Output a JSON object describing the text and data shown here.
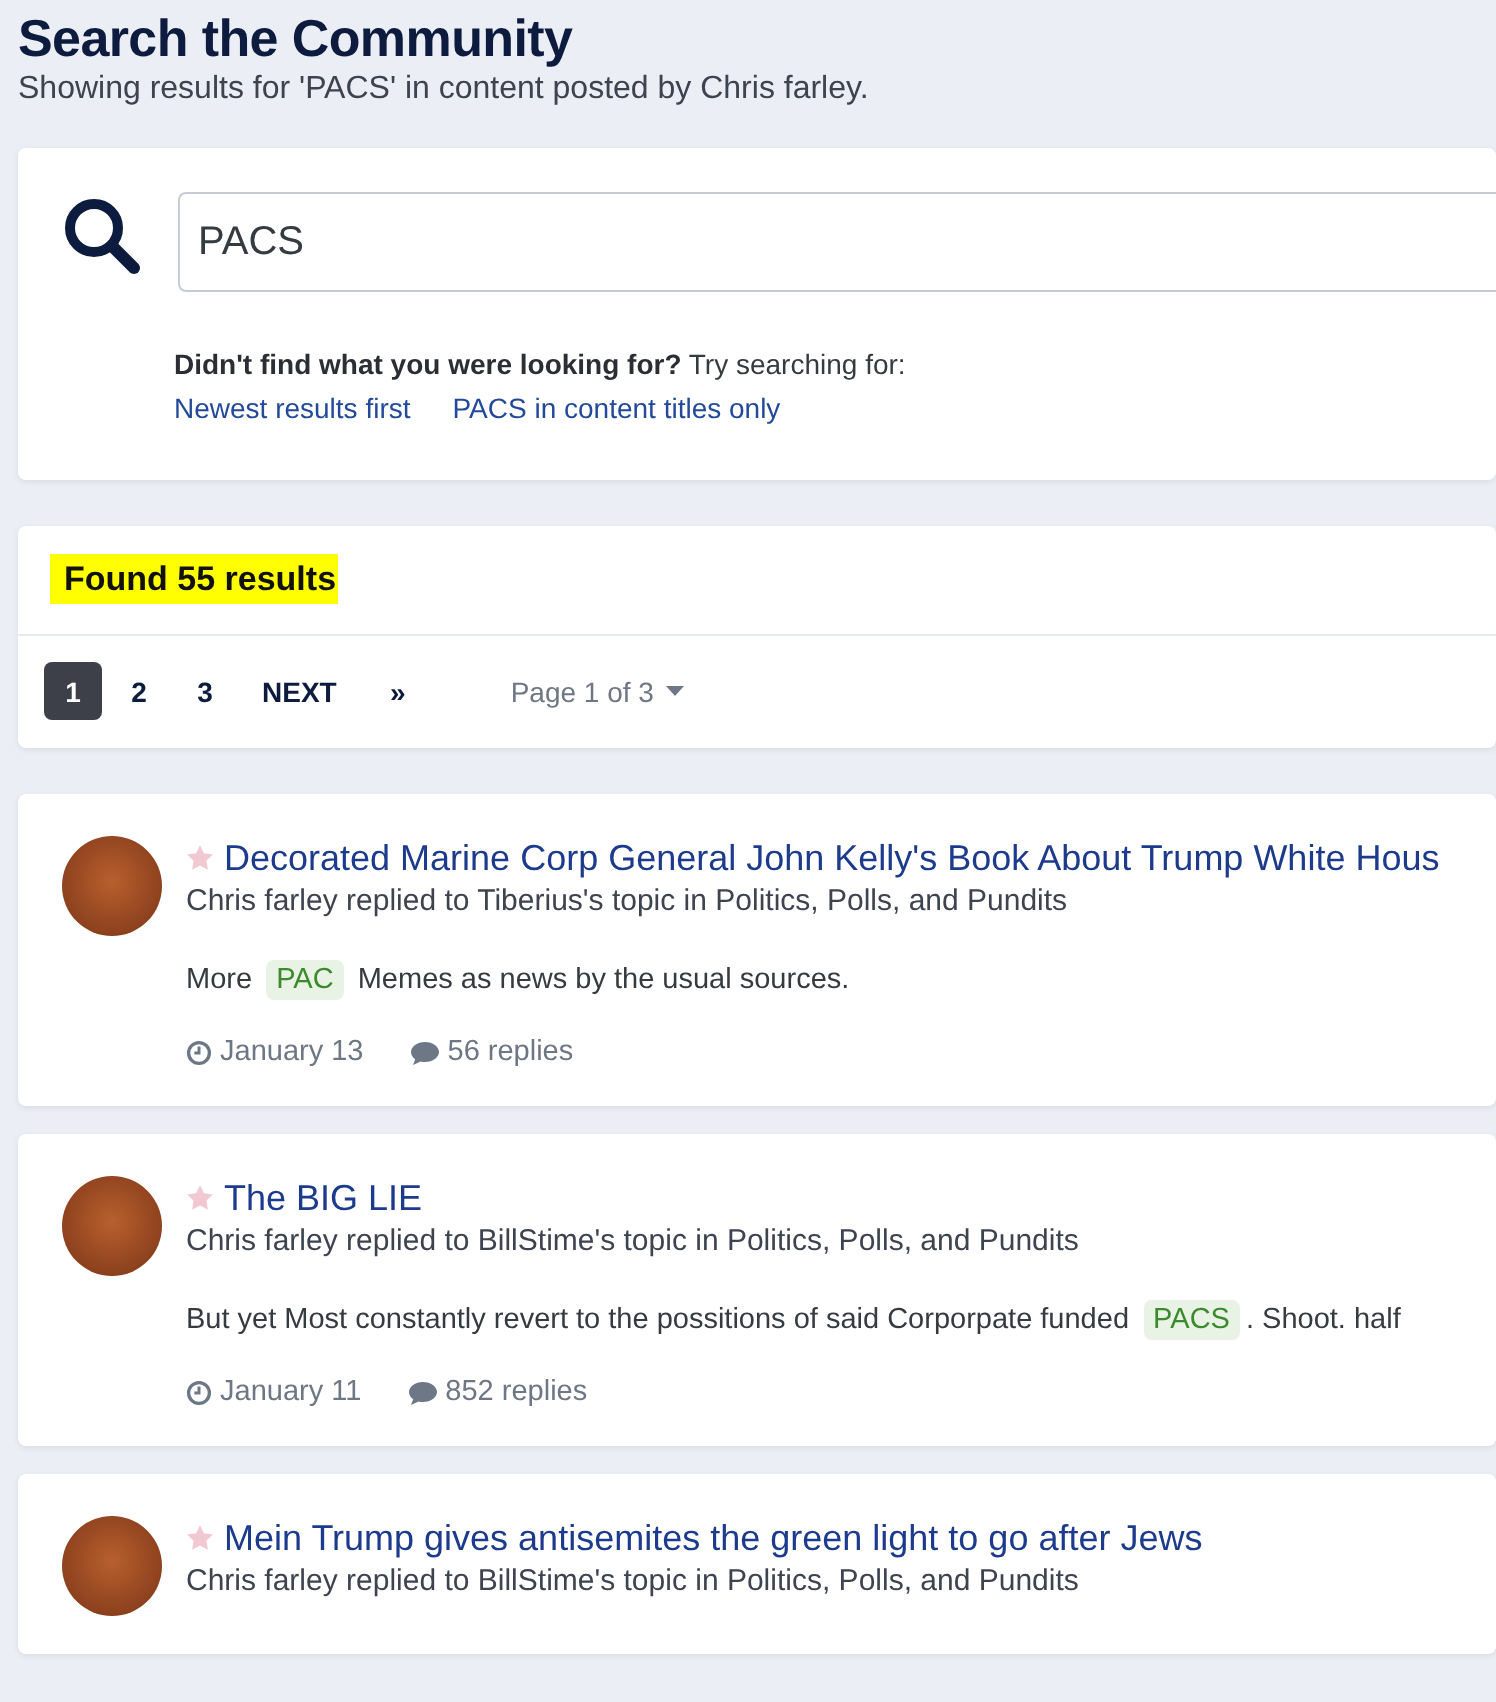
{
  "header": {
    "title": "Search the Community",
    "subtitle": "Showing results for 'PACS' in content posted by Chris farley."
  },
  "search": {
    "value": "PACS",
    "hint_bold": "Didn't find what you were looking for?",
    "hint": "Try searching for:",
    "suggestions": [
      "Newest results first",
      "PACS in content titles only"
    ]
  },
  "results": {
    "count": "Found 55 results",
    "pages": [
      {
        "label": "1",
        "selected": true
      },
      {
        "label": "2",
        "selected": false
      },
      {
        "label": "3",
        "selected": false
      }
    ],
    "next": "NEXT",
    "last": "»",
    "page_menu": "Page 1 of 3"
  },
  "items": [
    {
      "title": "Decorated Marine Corp General John Kelly's Book About Trump White Hous",
      "meta": "Chris farley replied to Tiberius's topic in Politics, Polls, and Pundits",
      "snippet": {
        "before": "More ",
        "highlight": "PAC",
        "after": " Memes as news by the usual sources."
      },
      "date": "January 13",
      "replies": "56 replies"
    },
    {
      "title": "The BIG LIE",
      "meta": "Chris farley replied to BillStime's topic in Politics, Polls, and Pundits",
      "snippet": {
        "before": "But yet Most constantly revert to the possitions of said Corporpate funded ",
        "highlight": "PACS",
        "after": ". Shoot. half"
      },
      "date": "January 11",
      "replies": "852 replies"
    },
    {
      "title": "Mein Trump gives antisemites the green light to go after Jews",
      "meta": "Chris farley replied to BillStime's topic in Politics, Polls, and Pundits"
    }
  ]
}
